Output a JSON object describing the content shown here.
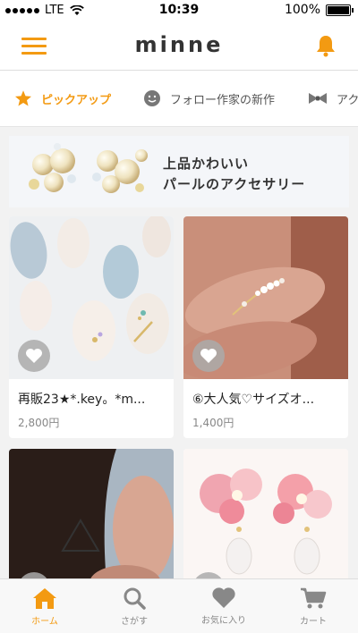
{
  "status": {
    "carrier": "LTE",
    "time": "10:39",
    "battery": "100%"
  },
  "header": {
    "logo": "minne"
  },
  "tabs": [
    {
      "label": "ピックアップ"
    },
    {
      "label": "フォロー作家の新作"
    },
    {
      "label": "アク"
    }
  ],
  "banner": {
    "line1": "上品かわいい",
    "line2": "パールのアクセサリー"
  },
  "products": [
    {
      "title": "再販23★*.key。*m...",
      "price": "2,800円"
    },
    {
      "title": "⑥大人気♡サイズオ...",
      "price": "1,400円"
    }
  ],
  "bottom_nav": [
    {
      "label": "ホーム"
    },
    {
      "label": "さがす"
    },
    {
      "label": "お気に入り"
    },
    {
      "label": "カート"
    }
  ],
  "colors": {
    "accent": "#f39a12"
  }
}
